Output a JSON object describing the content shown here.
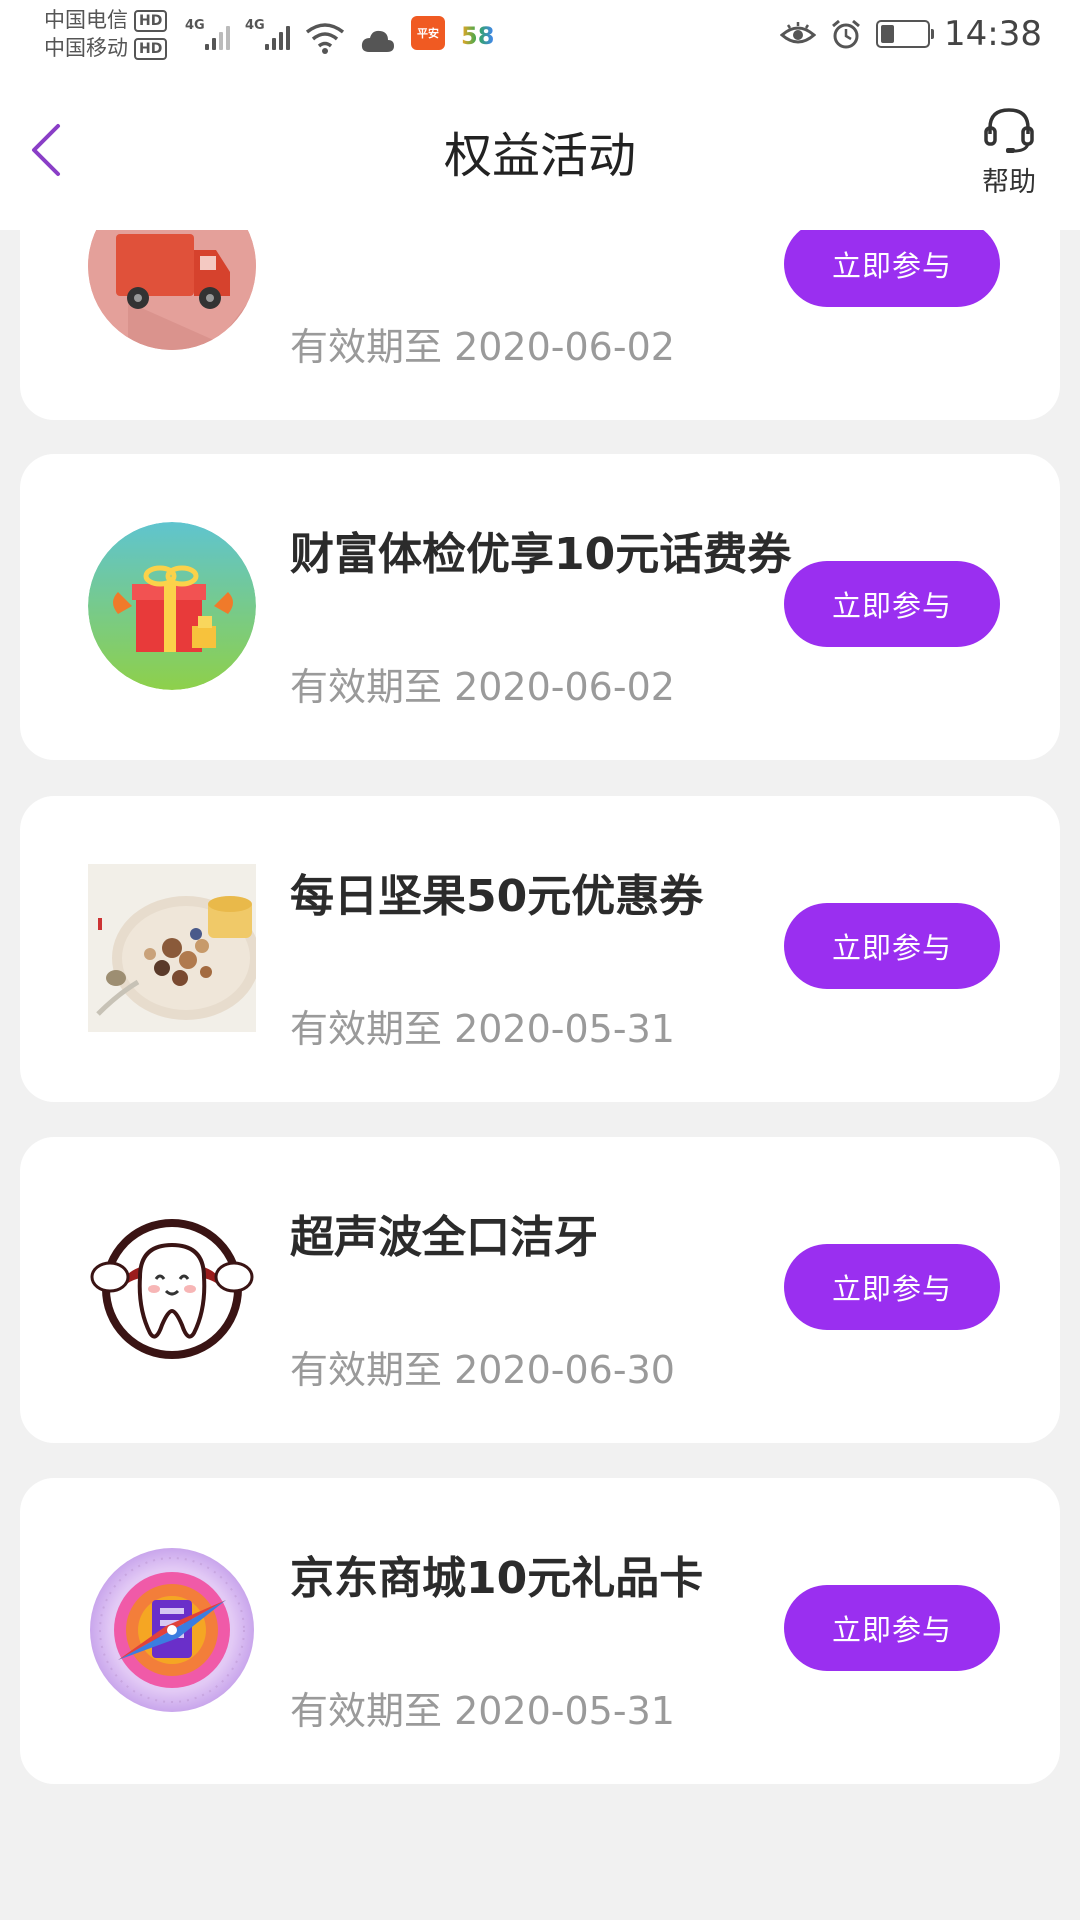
{
  "status_bar": {
    "carrier1": "中国电信",
    "carrier2": "中国移动",
    "hd": "HD",
    "net1": "4G",
    "net2": "4G",
    "app_badge": "平安",
    "app58": "58",
    "time": "14:38"
  },
  "header": {
    "title": "权益活动",
    "help_label": "帮助"
  },
  "theme": {
    "accent": "#9a2ff0",
    "background": "#f1f1f1",
    "card": "#ffffff",
    "date_gray": "#9a9a9a"
  },
  "activities": [
    {
      "title": "",
      "valid_until": "有效期至 2020-06-02",
      "button": "立即参与",
      "icon": "delivery-truck-icon"
    },
    {
      "title": "财富体检优享10元话费券",
      "valid_until": "有效期至 2020-06-02",
      "button": "立即参与",
      "icon": "gift-box-icon"
    },
    {
      "title": "每日坚果50元优惠券",
      "valid_until": "有效期至 2020-05-31",
      "button": "立即参与",
      "icon": "nuts-plate-icon"
    },
    {
      "title": "超声波全口洁牙",
      "valid_until": "有效期至 2020-06-30",
      "button": "立即参与",
      "icon": "tooth-mascot-icon"
    },
    {
      "title": "京东商城10元礼品卡",
      "valid_until": "有效期至 2020-05-31",
      "button": "立即参与",
      "icon": "compass-logo-icon"
    }
  ]
}
